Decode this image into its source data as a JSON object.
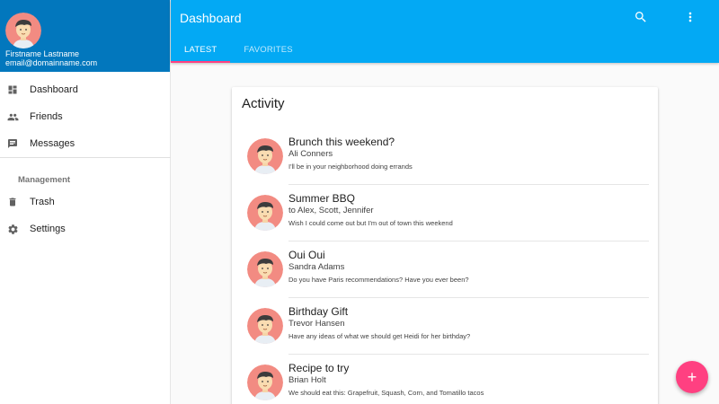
{
  "colors": {
    "drawer_header": "#0277bd",
    "appbar": "#03a9f4",
    "accent": "#ff4081",
    "avatar_bg": "#f28b82"
  },
  "drawer": {
    "user_name": "Firstname Lastname",
    "user_email": "email@domainname.com",
    "items": [
      {
        "label": "Dashboard",
        "icon": "dashboard-icon"
      },
      {
        "label": "Friends",
        "icon": "people-icon"
      },
      {
        "label": "Messages",
        "icon": "message-icon"
      }
    ],
    "section_label": "Management",
    "management_items": [
      {
        "label": "Trash",
        "icon": "trash-icon"
      },
      {
        "label": "Settings",
        "icon": "gear-icon"
      }
    ]
  },
  "appbar": {
    "title": "Dashboard",
    "tabs": [
      {
        "label": "LATEST",
        "active": true
      },
      {
        "label": "FAVORITES",
        "active": false
      }
    ],
    "actions": [
      "search-icon",
      "more-vert-icon"
    ]
  },
  "card": {
    "title": "Activity",
    "items": [
      {
        "title": "Brunch this weekend?",
        "subtitle": "Ali Conners",
        "body": "I'll be in your neighborhood doing errands"
      },
      {
        "title": "Summer BBQ",
        "subtitle": "to Alex, Scott, Jennifer",
        "body": "Wish I could come out but I'm out of town this weekend"
      },
      {
        "title": "Oui Oui",
        "subtitle": "Sandra Adams",
        "body": "Do you have Paris recommendations? Have you ever been?"
      },
      {
        "title": "Birthday Gift",
        "subtitle": "Trevor Hansen",
        "body": "Have any ideas of what we should get Heidi for her birthday?"
      },
      {
        "title": "Recipe to try",
        "subtitle": "Brian Holt",
        "body": "We should eat this: Grapefruit, Squash, Corn, and Tomatillo tacos"
      }
    ]
  },
  "fab": {
    "label": "+",
    "icon": "add-icon"
  }
}
